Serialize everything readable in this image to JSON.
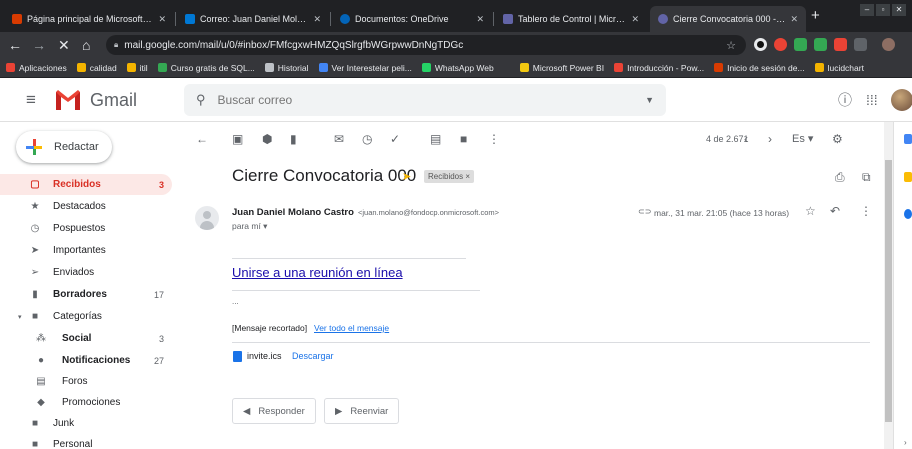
{
  "browser": {
    "tabs": [
      {
        "label": "Página principal de Microsoft Of",
        "favicon_color": "#d83b01",
        "active": false
      },
      {
        "label": "Correo: Juan Daniel Molano Cas",
        "favicon_color": "#0078d4",
        "active": false
      },
      {
        "label": "Documentos: OneDrive",
        "favicon_color": "#0364b8",
        "active": false
      },
      {
        "label": "Tablero de Control | Microsoft T",
        "favicon_color": "#6264a7",
        "active": false
      },
      {
        "label": "Cierre Convocatoria 000 - jdmo",
        "favicon_color": "#6264a7",
        "active": true
      }
    ],
    "new_tab_symbol": "+",
    "url": "mail.google.com/mail/u/0/#inbox/FMfcgxwHMZQqSlrgfbWGrpwwDnNgTDGc",
    "bookmarks": [
      {
        "label": "Aplicaciones",
        "icon_color": "#ea4335"
      },
      {
        "label": "calidad",
        "icon_color": "#f4b400"
      },
      {
        "label": "itil",
        "icon_color": "#f4b400"
      },
      {
        "label": "Curso gratis de SQL...",
        "icon_color": "#34a853"
      },
      {
        "label": "Historial",
        "icon_color": "#bdc1c6"
      },
      {
        "label": "Ver Interestelar peli...",
        "icon_color": "#4285f4"
      },
      {
        "label": "WhatsApp Web",
        "icon_color": "#25d366"
      },
      {
        "label": "Microsoft Power BI",
        "icon_color": "#f2c811"
      },
      {
        "label": "Introducción - Pow...",
        "icon_color": "#ea4335"
      },
      {
        "label": "Inicio de sesión de...",
        "icon_color": "#d83b01"
      },
      {
        "label": "lucidchart",
        "icon_color": "#f4b400"
      }
    ]
  },
  "gmail": {
    "app_name": "Gmail",
    "search_placeholder": "Buscar correo",
    "compose_label": "Redactar",
    "nav": [
      {
        "label": "Recibidos",
        "count": "3",
        "icon": "inbox-icon",
        "glyph": "▢"
      },
      {
        "label": "Destacados",
        "count": "",
        "icon": "star-icon",
        "glyph": "★"
      },
      {
        "label": "Pospuestos",
        "count": "",
        "icon": "clock-icon",
        "glyph": "◷"
      },
      {
        "label": "Importantes",
        "count": "",
        "icon": "important-icon",
        "glyph": "➤"
      },
      {
        "label": "Enviados",
        "count": "",
        "icon": "send-icon",
        "glyph": "➢"
      },
      {
        "label": "Borradores",
        "count": "17",
        "icon": "draft-icon",
        "glyph": "▮"
      },
      {
        "label": "Categorías",
        "count": "",
        "icon": "label-icon",
        "glyph": "■"
      },
      {
        "label": "Social",
        "count": "3",
        "icon": "people-icon",
        "glyph": "⁂"
      },
      {
        "label": "Notificaciones",
        "count": "27",
        "icon": "info-icon",
        "glyph": "●"
      },
      {
        "label": "Foros",
        "count": "",
        "icon": "forum-icon",
        "glyph": "▤"
      },
      {
        "label": "Promociones",
        "count": "",
        "icon": "tag-icon",
        "glyph": "◆"
      },
      {
        "label": "Junk",
        "count": "",
        "icon": "label-icon",
        "glyph": "■"
      },
      {
        "label": "Personal",
        "count": "",
        "icon": "label-icon",
        "glyph": "■"
      }
    ],
    "pager": "4 de 2.671",
    "message": {
      "subject": "Cierre Convocatoria 000",
      "label_chip": "Recibidos ×",
      "sender_name": "Juan Daniel Molano Castro",
      "sender_email": "<juan.molano@fondocp.onmicrosoft.com>",
      "recipient": "para mí ▾",
      "date": "mar., 31 mar. 21:05 (hace 13 horas)",
      "meeting_link": "Unirse a una reunión en línea",
      "ellipsis": "...",
      "clipped_text": "[Mensaje recortado]",
      "view_all": "Ver todo el mensaje",
      "attachment_name": "invite.ics",
      "attachment_download": "Descargar",
      "reply_label": "Responder",
      "forward_label": "Reenviar"
    }
  },
  "colors": {
    "accent_red": "#d93025",
    "active_bg": "#fce8e6",
    "link_blue": "#1a0dab"
  }
}
